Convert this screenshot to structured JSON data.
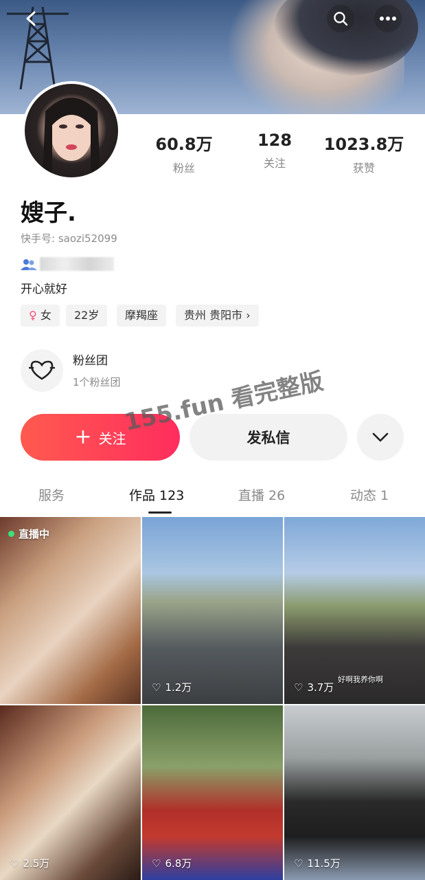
{
  "header": {
    "back_icon": "chevron-left-icon",
    "search_icon": "search-icon",
    "more_icon": "more-dots-icon"
  },
  "profile": {
    "stats": [
      {
        "value": "60.8万",
        "label": "粉丝"
      },
      {
        "value": "128",
        "label": "关注"
      },
      {
        "value": "1023.8万",
        "label": "获赞"
      }
    ],
    "name": "嫂子.",
    "account_id": "快手号: saozi52099",
    "bio": "开心就好",
    "tags": {
      "gender": "女",
      "age": "22岁",
      "zodiac": "摩羯座",
      "location": "贵州 贵阳市"
    }
  },
  "fan_group": {
    "title": "粉丝团",
    "subtitle": "1个粉丝团"
  },
  "actions": {
    "follow_label": "关注",
    "message_label": "发私信"
  },
  "watermark": "155.fun 看完整版",
  "tabs": [
    {
      "label": "服务"
    },
    {
      "label": "作品 123",
      "active": true
    },
    {
      "label": "直播 26"
    },
    {
      "label": "动态 1"
    }
  ],
  "videos": [
    {
      "badge": "直播中"
    },
    {
      "likes": "1.2万"
    },
    {
      "likes": "3.7万",
      "caption": "好啊我养你啊"
    },
    {
      "likes": "2.5万"
    },
    {
      "likes": "6.8万"
    },
    {
      "likes": "11.5万"
    }
  ],
  "colors": {
    "follow_gradient_start": "#ff5a4f",
    "follow_gradient_end": "#ff2d5e",
    "live_dot": "#3ee07a"
  }
}
